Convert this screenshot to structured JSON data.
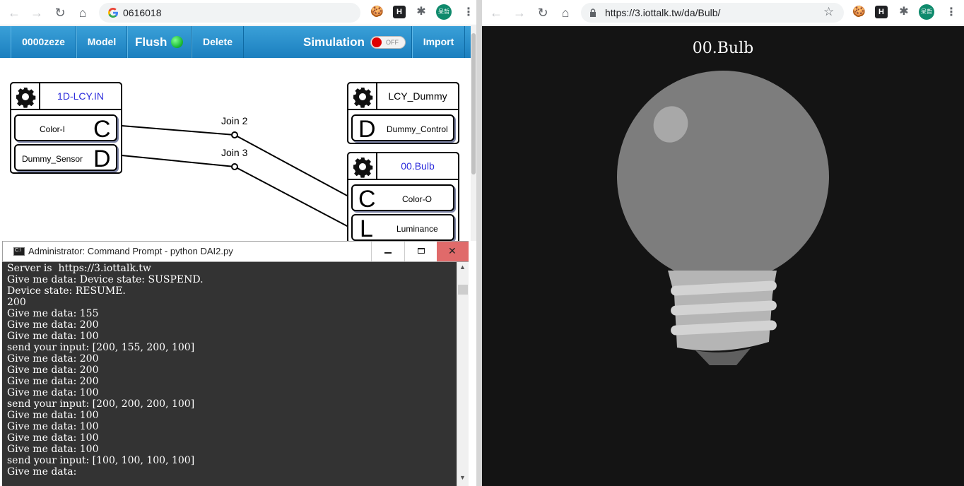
{
  "left_browser": {
    "omnibox_text": "0616018",
    "avatar_text": "呆哲"
  },
  "right_browser": {
    "url": "https://3.iottalk.tw/da/Bulb/",
    "avatar_text": "呆哲"
  },
  "iot_toolbar": {
    "project": "0000zeze",
    "model": "Model",
    "flush": "Flush",
    "delete": "Delete",
    "simulation": "Simulation",
    "simulation_state": "OFF",
    "import": "Import"
  },
  "devices": {
    "input_device": {
      "name": "1D-LCY.IN",
      "features": [
        {
          "label": "Color-I",
          "letter": "C"
        },
        {
          "label": "Dummy_Sensor",
          "letter": "D"
        }
      ]
    },
    "dummy_device": {
      "name": "LCY_Dummy",
      "features": [
        {
          "label": "Dummy_Control",
          "letter": "D"
        }
      ]
    },
    "bulb_device": {
      "name": "00.Bulb",
      "features": [
        {
          "label": "Color-O",
          "letter": "C"
        },
        {
          "label": "Luminance",
          "letter": "L"
        }
      ]
    }
  },
  "joins": [
    {
      "label": "Join 2"
    },
    {
      "label": "Join 3"
    }
  ],
  "cmd": {
    "title": "Administrator: Command Prompt - python  DAI2.py",
    "lines": [
      "Server is  https://3.iottalk.tw",
      "Give me data: Device state: SUSPEND.",
      "Device state: RESUME.",
      "200",
      "Give me data: 155",
      "Give me data: 200",
      "Give me data: 100",
      "send your input: [200, 155, 200, 100]",
      "Give me data: 200",
      "Give me data: 200",
      "Give me data: 200",
      "Give me data: 100",
      "send your input: [200, 200, 200, 100]",
      "Give me data: 100",
      "Give me data: 100",
      "Give me data: 100",
      "Give me data: 100",
      "send your input: [100, 100, 100, 100]",
      "Give me data:"
    ]
  },
  "bulb_page": {
    "title": "00.Bulb"
  },
  "colors": {
    "iot_blue": "#1b7fbf",
    "device_blue_text": "#2b2bdb",
    "cmd_bg": "#333333",
    "bulb_bg": "#141414",
    "bulb_glass": "#7d7d7d",
    "flush_indicator": "#1fbf3a",
    "sim_toggle_red": "#e00000",
    "close_button_red": "#e06a6a"
  }
}
